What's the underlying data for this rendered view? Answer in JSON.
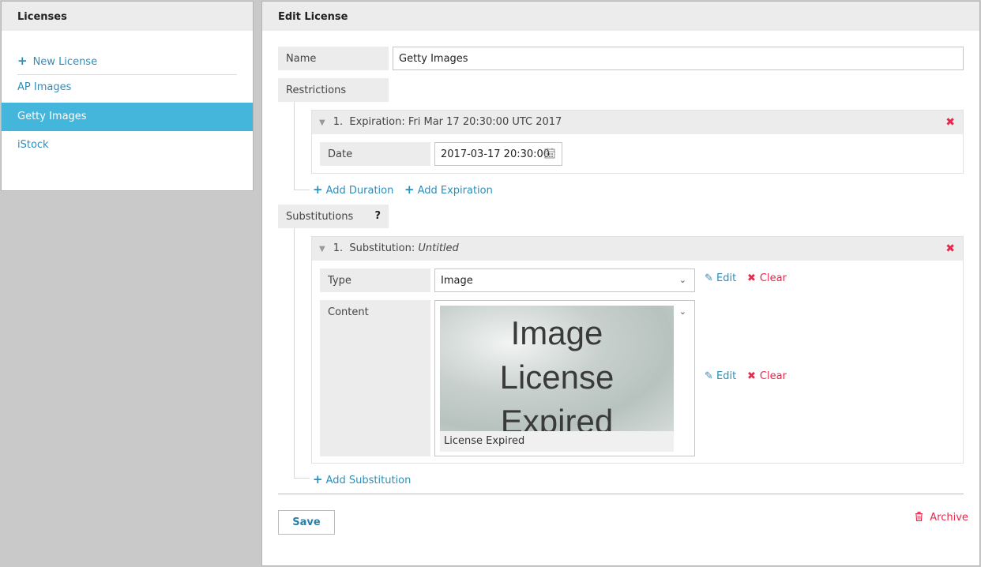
{
  "left_panel": {
    "title": "Licenses",
    "new_license_label": "New License",
    "items": [
      {
        "label": "AP Images"
      },
      {
        "label": "Getty Images"
      },
      {
        "label": "iStock"
      }
    ]
  },
  "right_panel": {
    "title": "Edit License",
    "name_label": "Name",
    "name_value": "Getty Images",
    "restrictions_label": "Restrictions",
    "restriction": {
      "index": "1.",
      "title": "Expiration: Fri Mar 17 20:30:00 UTC 2017",
      "date_label": "Date",
      "date_value": "2017-03-17 20:30:00"
    },
    "add_duration_label": "Add Duration",
    "add_expiration_label": "Add Expiration",
    "substitutions_label": "Substitutions",
    "help_glyph": "?",
    "substitution": {
      "index": "1.",
      "title_prefix": "Substitution:",
      "title_name": "Untitled",
      "type_label": "Type",
      "type_value": "Image",
      "content_label": "Content",
      "preview_lines": [
        "Image",
        "License",
        "Expired"
      ],
      "preview_caption": "License Expired",
      "edit_label": "Edit",
      "clear_label": "Clear"
    },
    "add_substitution_label": "Add Substitution",
    "save_label": "Save",
    "archive_label": "Archive"
  },
  "colors": {
    "accent": "#44b5db",
    "link": "#2a8fbd",
    "danger": "#e5284b"
  }
}
